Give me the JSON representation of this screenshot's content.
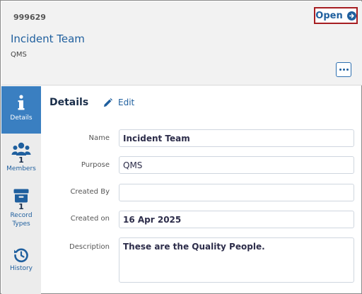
{
  "header": {
    "record_id": "999629",
    "open_label": "Open",
    "title": "Incident Team",
    "subtitle": "QMS",
    "more_icon": "ellipsis-icon"
  },
  "sidebar": {
    "items": [
      {
        "label": "Details",
        "icon": "info-icon",
        "active": true
      },
      {
        "label": "Members",
        "count": "1",
        "icon": "users-icon"
      },
      {
        "label_line1": "Record",
        "label_line2": "Types",
        "count": "1",
        "icon": "archive-box-icon"
      },
      {
        "label": "History",
        "icon": "history-icon"
      }
    ]
  },
  "details": {
    "section_title": "Details",
    "edit_label": "Edit",
    "fields": {
      "name": {
        "label": "Name",
        "value": "Incident Team"
      },
      "purpose": {
        "label": "Purpose",
        "value": "QMS"
      },
      "created_by": {
        "label": "Created By",
        "value": ""
      },
      "created_on": {
        "label": "Created on",
        "value": "16 Apr 2025"
      },
      "description": {
        "label": "Description",
        "value": "These are the Quality People."
      }
    }
  },
  "colors": {
    "accent": "#1f5f9e",
    "active_tab": "#3a7fc1",
    "highlight_border": "#a61e22"
  }
}
